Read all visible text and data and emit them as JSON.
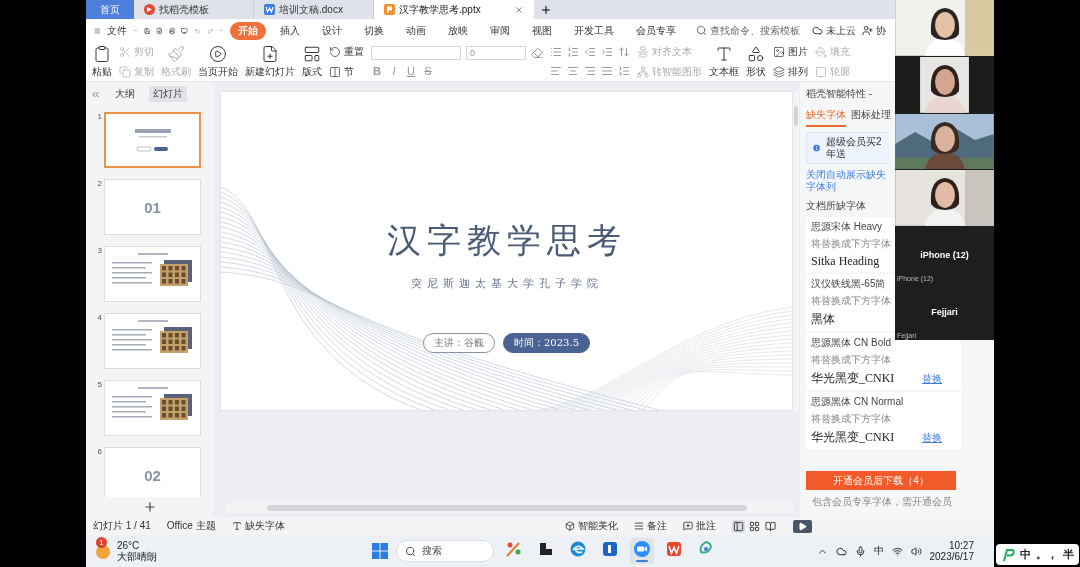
{
  "tabs": [
    {
      "label": "首页",
      "kind": "home",
      "selected": false
    },
    {
      "label": "找稻壳模板",
      "kind": "docer",
      "selected": false
    },
    {
      "label": "培训文稿.docx",
      "kind": "word",
      "selected": false
    },
    {
      "label": "汉字教学思考.pptx",
      "kind": "slides",
      "selected": true
    }
  ],
  "menu": {
    "file": "文件",
    "search_placeholder": "查找命令、搜索模板",
    "cloud": "未上云",
    "share": "协",
    "tabs": [
      {
        "label": "开始",
        "selected": true
      },
      {
        "label": "插入",
        "selected": false
      },
      {
        "label": "设计",
        "selected": false
      },
      {
        "label": "切换",
        "selected": false
      },
      {
        "label": "动画",
        "selected": false
      },
      {
        "label": "放映",
        "selected": false
      },
      {
        "label": "审阅",
        "selected": false
      },
      {
        "label": "视图",
        "selected": false
      },
      {
        "label": "开发工具",
        "selected": false
      },
      {
        "label": "会员专享",
        "selected": false
      }
    ]
  },
  "ribbon": [
    {
      "kind": "big",
      "label": "粘贴",
      "disabled": false
    },
    {
      "kind": "stack",
      "items": [
        {
          "label": "剪切",
          "disabled": true
        },
        {
          "label": "复制",
          "disabled": true
        }
      ]
    },
    {
      "kind": "big",
      "label": "格式刷",
      "disabled": true
    },
    {
      "kind": "big",
      "label": "当页开始",
      "disabled": false
    },
    {
      "kind": "big",
      "label": "新建幻灯片",
      "disabled": false
    },
    {
      "kind": "big",
      "label": "版式",
      "disabled": false
    },
    {
      "kind": "stack",
      "items": [
        {
          "label": "重置",
          "disabled": false
        },
        {
          "label": "节",
          "disabled": false
        }
      ]
    },
    {
      "kind": "font",
      "size": "0",
      "styles": [
        "B",
        "I",
        "U",
        "S"
      ]
    },
    {
      "kind": "paragraph"
    },
    {
      "kind": "stack",
      "items": [
        {
          "label": "对齐文本",
          "disabled": true
        },
        {
          "label": "转智能图形",
          "disabled": true
        }
      ]
    },
    {
      "kind": "big",
      "label": "文本框",
      "disabled": false
    },
    {
      "kind": "big",
      "label": "形状",
      "disabled": false
    },
    {
      "kind": "stack",
      "items": [
        {
          "label": "图片",
          "disabled": false
        },
        {
          "label": "排列",
          "disabled": false
        }
      ]
    },
    {
      "kind": "stack",
      "items": [
        {
          "label": "填充",
          "disabled": true
        },
        {
          "label": "轮廓",
          "disabled": true
        }
      ]
    }
  ],
  "slide_panel": {
    "views": [
      {
        "label": "大纲",
        "selected": false
      },
      {
        "label": "幻灯片",
        "selected": true
      }
    ],
    "thumbnails": [
      {
        "number": "1",
        "kind": "title",
        "selected": true
      },
      {
        "number": "2",
        "kind": "section",
        "big": "01",
        "selected": false
      },
      {
        "number": "3",
        "kind": "content",
        "selected": false
      },
      {
        "number": "4",
        "kind": "content",
        "selected": false
      },
      {
        "number": "5",
        "kind": "content",
        "selected": false
      },
      {
        "number": "6",
        "kind": "section",
        "big": "02",
        "selected": false
      }
    ]
  },
  "slide": {
    "title": "汉字教学思考",
    "subtitle": "突尼斯迦太基大学孔子学院",
    "speaker": "主讲：谷巍",
    "date": "时间：2023.5"
  },
  "font_panel": {
    "header": "稻壳智能特性 -",
    "tabs": [
      {
        "label": "缺失字体",
        "selected": true
      },
      {
        "label": "图标处理",
        "selected": false
      }
    ],
    "notice": "超级会员买2年送",
    "link": "关闭自动展示缺失字体列",
    "section": "文档所缺字体",
    "fonts": [
      {
        "name": "思源宋体 Heavy",
        "hint": "将替换成下方字体",
        "replacement": "Sitka Heading"
      },
      {
        "name": "汉仪铁线黑-65简",
        "hint": "将替换成下方字体",
        "replacement": "黑体"
      },
      {
        "name": "思源黑体 CN Bold",
        "hint": "将替换成下方字体",
        "replacement": "华光黑变_CNKI",
        "action": "替换"
      },
      {
        "name": "思源黑体 CN Normal",
        "hint": "将替换成下方字体",
        "replacement": "华光黑变_CNKI",
        "action": "替换"
      }
    ],
    "download": "开通会员后下载（4）",
    "note": "包含会员专享字体，需开通会员"
  },
  "status_bar": {
    "slide_count": "幻灯片 1 / 41",
    "theme": "Office 主题",
    "missing_fonts": "缺失字体",
    "beautify": "智能美化",
    "notes": "备注",
    "comments": "批注",
    "views": [
      {
        "selected": true
      },
      {
        "selected": false
      },
      {
        "selected": false
      }
    ]
  },
  "taskbar": {
    "weather": {
      "badge": "1",
      "temp": "26°C",
      "desc": "大部晴朗"
    },
    "search": "搜索",
    "apps": [
      {
        "selected": false
      },
      {
        "selected": false
      },
      {
        "selected": false
      },
      {
        "selected": false
      },
      {
        "selected": true
      },
      {
        "selected": false
      },
      {
        "selected": false
      }
    ],
    "ime": "中",
    "time": "10:27",
    "date": "2023/6/17"
  },
  "video_call": {
    "tiles": [
      {
        "kind": "picture"
      },
      {
        "kind": "picture"
      },
      {
        "kind": "picture"
      },
      {
        "kind": "picture"
      },
      {
        "kind": "name",
        "name": "iPhone (12)",
        "label": "iPhone (12)"
      },
      {
        "kind": "name",
        "name": "Fejjari",
        "label": "Fejjari"
      }
    ]
  },
  "ime_toolbar": {
    "mode": "中",
    "punctuation": "。，",
    "width": "半"
  }
}
